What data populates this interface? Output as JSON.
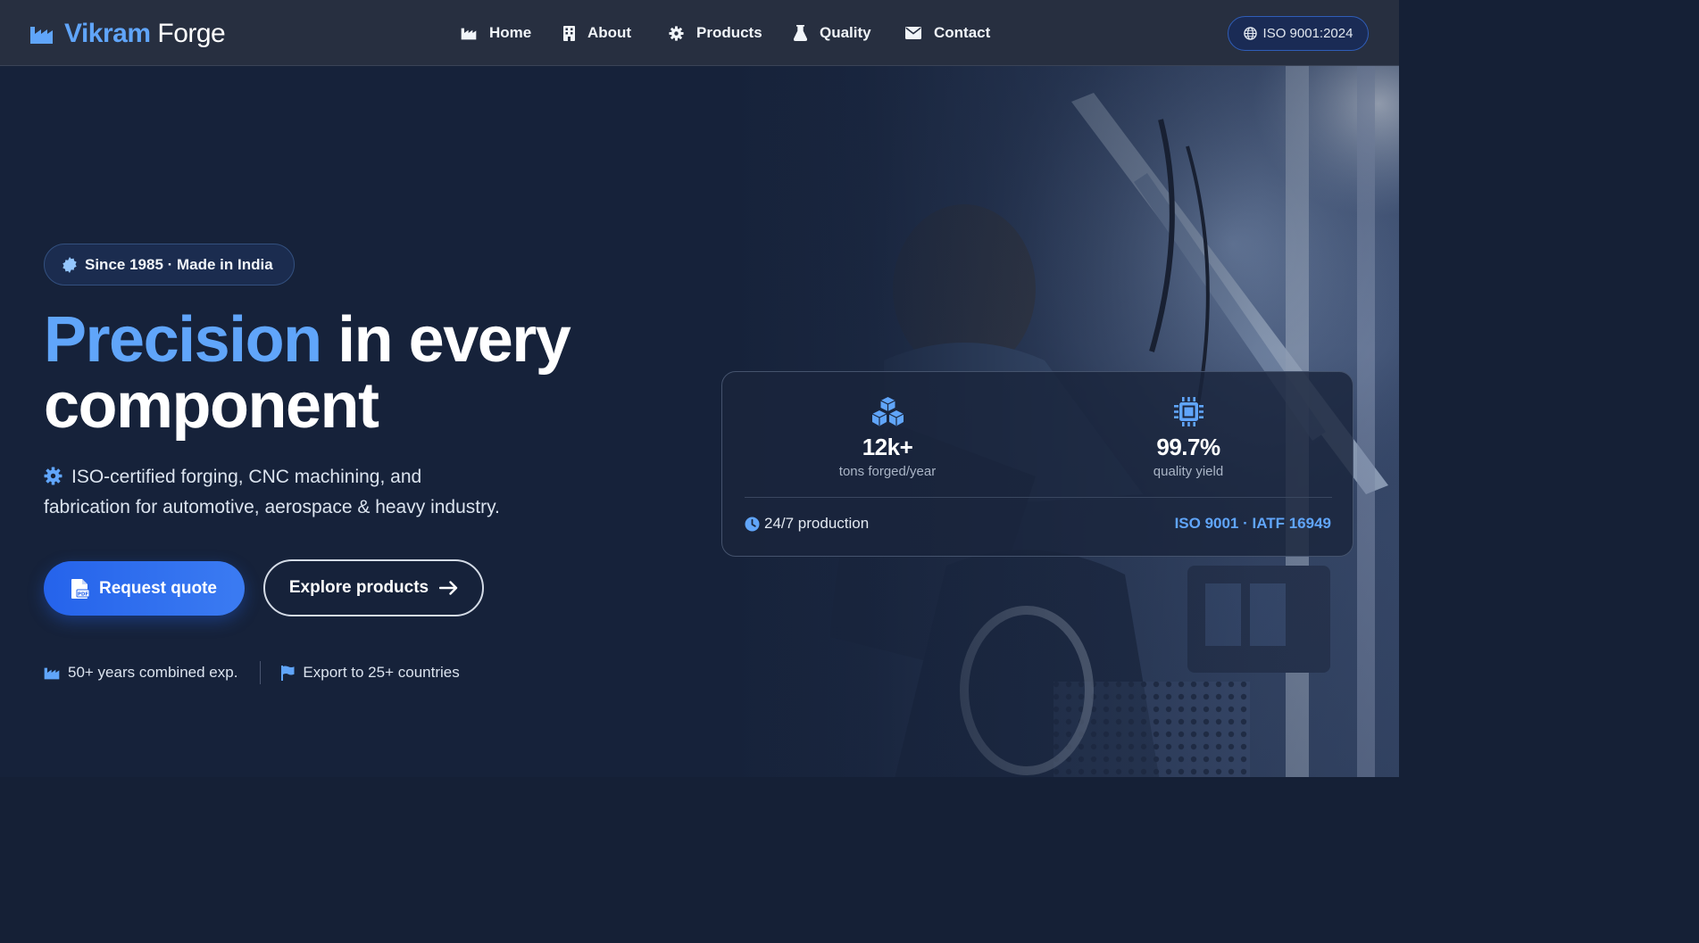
{
  "brand": {
    "name_accent": "Vikram",
    "name_rest": "Forge",
    "icon": "factory-icon"
  },
  "nav": {
    "items": [
      {
        "label": "Home",
        "icon": "factory-icon"
      },
      {
        "label": "About",
        "icon": "building-icon"
      },
      {
        "label": "Products",
        "icon": "gear-icon"
      },
      {
        "label": "Quality",
        "icon": "flask-icon"
      },
      {
        "label": "Contact",
        "icon": "envelope-icon"
      }
    ],
    "cert_badge": {
      "label": "ISO 9001:2024",
      "icon": "globe-icon"
    }
  },
  "hero": {
    "badge": {
      "label": "Since 1985 · Made in India",
      "icon": "certificate-icon"
    },
    "headline": {
      "highlight": "Precision",
      "line1_rest": "in every",
      "line2": "component"
    },
    "subtext": {
      "icon": "gear-icon",
      "line1": "ISO-certified forging, CNC machining, and",
      "line2": "fabrication for automotive, aerospace & heavy industry."
    },
    "primary_button": {
      "label": "Request quote",
      "icon": "file-pdf-icon"
    },
    "secondary_button": {
      "label": "Explore products",
      "icon": "arrow-right-icon"
    },
    "trust": [
      {
        "label": "50+ years combined exp.",
        "icon": "factory-icon"
      },
      {
        "label": "Export to 25+ countries",
        "icon": "flag-icon"
      }
    ]
  },
  "stats_card": {
    "stats": [
      {
        "value": "12k+",
        "label": "tons forged/year",
        "icon": "cubes-icon"
      },
      {
        "value": "99.7%",
        "label": "quality yield",
        "icon": "microchip-icon"
      }
    ],
    "footer_left": {
      "label": "24/7 production",
      "icon": "clock-icon"
    },
    "footer_right": "ISO 9001 · IATF 16949"
  },
  "colors": {
    "accent": "#60a5fa",
    "primary_button": "#2563eb",
    "nav_bg": "#272f40",
    "hero_bg": "#16223a"
  }
}
